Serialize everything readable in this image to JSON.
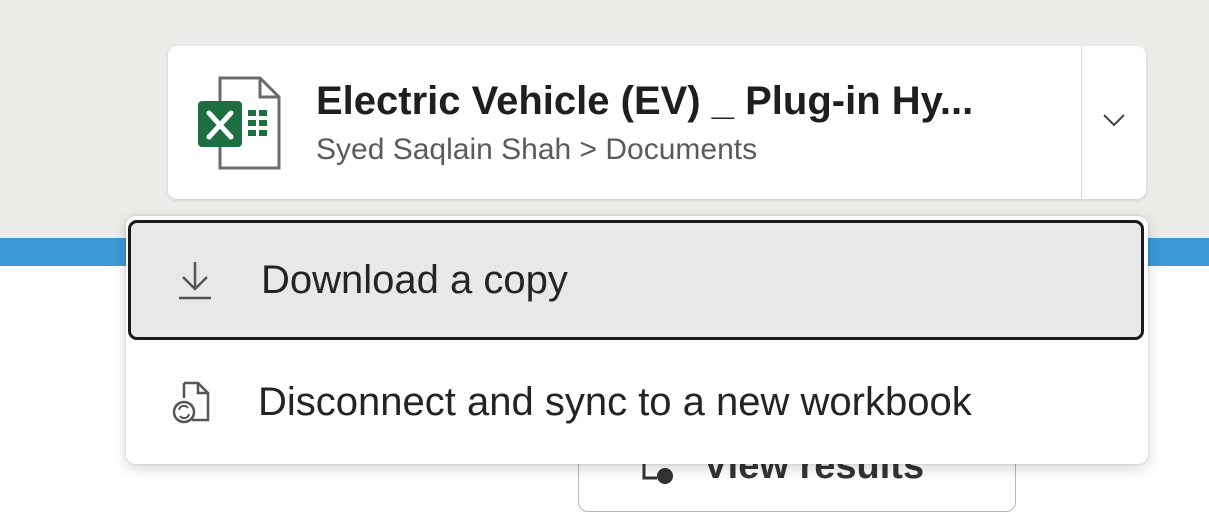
{
  "file_card": {
    "title": "Electric Vehicle (EV) _ Plug-in Hy...",
    "path": "Syed Saqlain Shah > Documents",
    "icon": "excel-file-icon",
    "expand_icon": "chevron-down-icon"
  },
  "menu": {
    "items": [
      {
        "label": "Download a copy",
        "icon": "download-icon",
        "state": "focused"
      },
      {
        "label": "Disconnect and sync to a new workbook",
        "icon": "document-sync-icon"
      }
    ]
  },
  "background_button": {
    "label": "View results",
    "icon": "view-results-icon"
  },
  "colors": {
    "top_background": "#ebece8",
    "accent_stripe": "#3c98d6",
    "excel_green": "#1d6f42",
    "focus_border": "#1a1a1a",
    "selected_fill": "#e8e8e8"
  }
}
